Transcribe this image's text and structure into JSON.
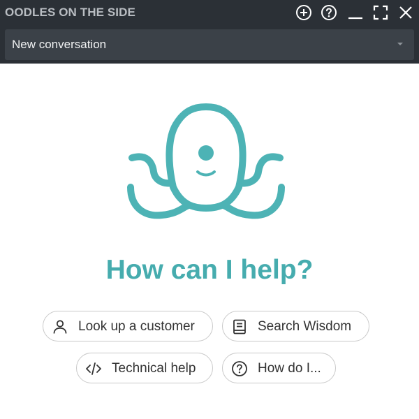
{
  "header": {
    "title": "OODLES ON THE SIDE",
    "controls": [
      {
        "name": "new-conversation",
        "icon": "plus-circle-icon"
      },
      {
        "name": "help",
        "icon": "question-circle-icon"
      },
      {
        "name": "minimize",
        "icon": "minimize-icon"
      },
      {
        "name": "maximize",
        "icon": "maximize-icon"
      },
      {
        "name": "close",
        "icon": "close-icon"
      }
    ]
  },
  "conversation_select": {
    "selected": "New conversation"
  },
  "main": {
    "mascot_icon": "octopus-icon",
    "heading": "How can I help?",
    "quick_actions": [
      {
        "label": "Look up a customer",
        "icon": "person-icon"
      },
      {
        "label": "Search Wisdom",
        "icon": "book-icon"
      },
      {
        "label": "Technical help",
        "icon": "code-icon"
      },
      {
        "label": "How do I...",
        "icon": "question-circle-icon"
      }
    ]
  },
  "colors": {
    "header_bg": "#2b3036",
    "select_bg": "#3b4148",
    "accent": "#46acae",
    "chip_border": "#c9c9c9",
    "text": "#333333"
  }
}
